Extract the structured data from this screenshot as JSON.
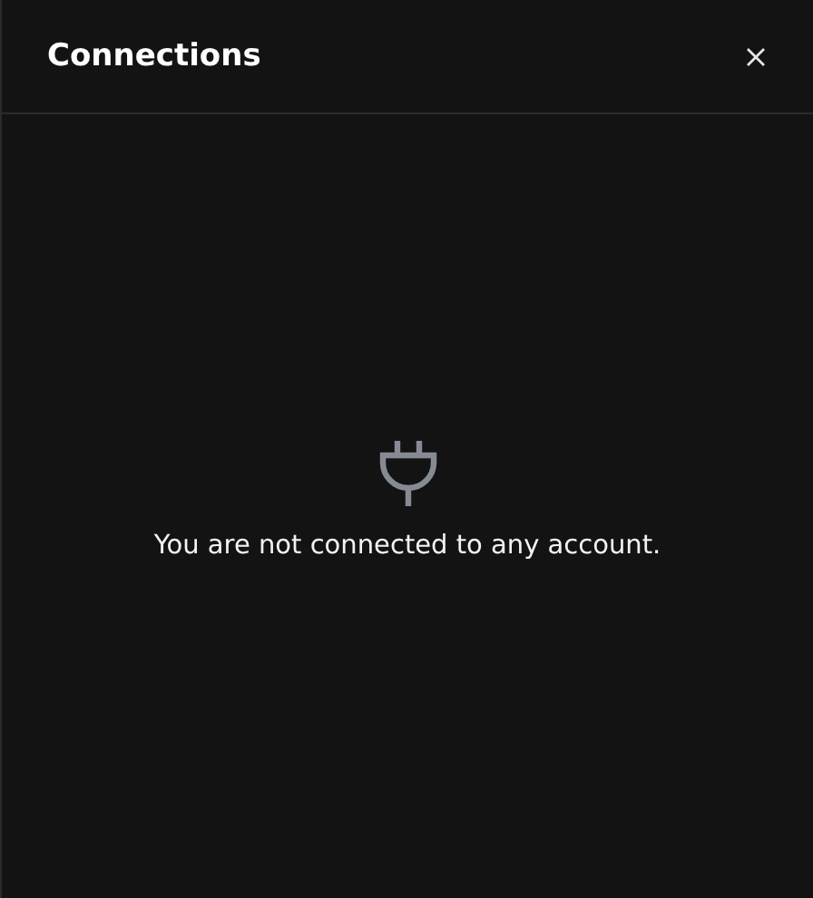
{
  "panel": {
    "title": "Connections"
  },
  "empty_state": {
    "message": "You are not connected to any account."
  }
}
